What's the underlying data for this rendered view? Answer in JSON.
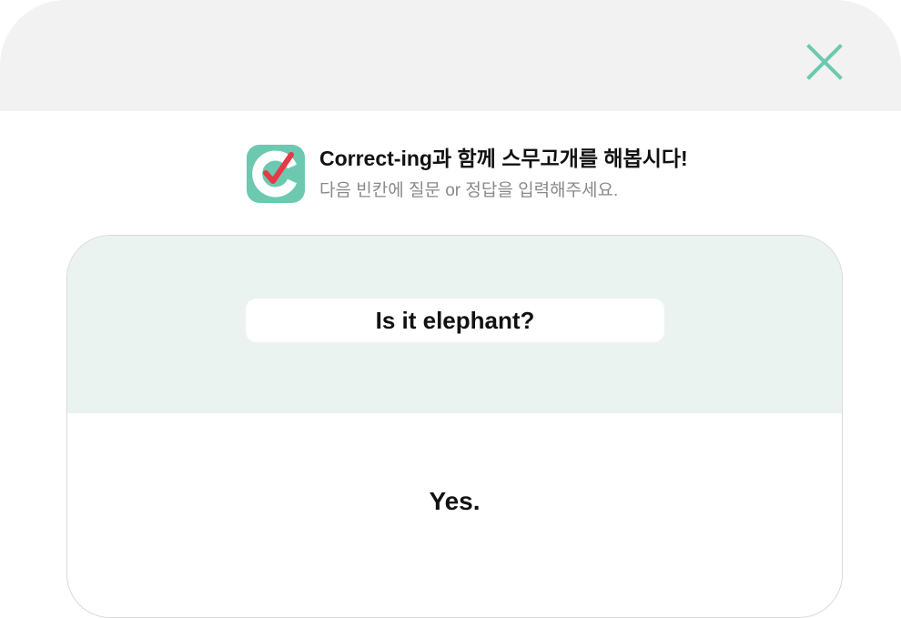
{
  "modal": {
    "close_icon": "close-x-icon",
    "accent_color": "#6cc9b0"
  },
  "intro": {
    "logo_icon": "correct-ing-checkmark-logo",
    "title": "Correct-ing과 함께 스무고개를 해봅시다!",
    "subtitle": "다음 빈칸에 질문 or 정답을 입력해주세요."
  },
  "card": {
    "question": "Is it elephant?",
    "answer": "Yes."
  }
}
